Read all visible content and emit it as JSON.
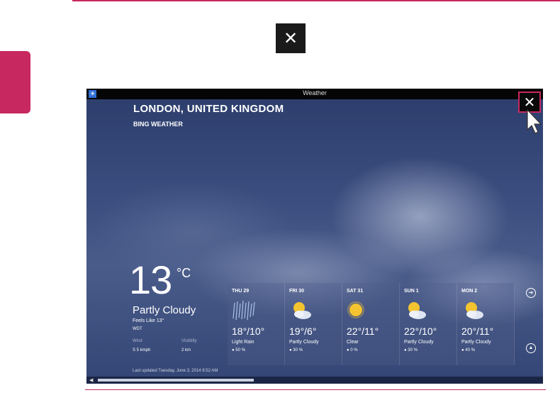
{
  "page": {
    "close_glyph": "✕"
  },
  "window": {
    "title": "Weather",
    "close_glyph": "✕",
    "app_icon_glyph": "☀"
  },
  "location": {
    "city": "LONDON, UNITED KINGDOM",
    "provider": "BING WEATHER"
  },
  "current": {
    "temperature": "13",
    "unit": "°C",
    "condition": "Partly Cloudy",
    "feels_like": "Feels Like 13°",
    "station": "WDT",
    "wind_label": "Wind",
    "wind_value": "S 5 kmph",
    "visibility_label": "Visibility",
    "visibility_value": "2 km",
    "last_updated": "Last updated Tuesday, June 3, 2014 8:52 AM"
  },
  "forecast": [
    {
      "day": "THU 29",
      "temp": "18°/10°",
      "condition": "Light Rain",
      "precip": "50 %",
      "icon": "rain-icon"
    },
    {
      "day": "FRI 30",
      "temp": "19°/6°",
      "condition": "Partly Cloudy",
      "precip": "30 %",
      "icon": "partly-cloudy-icon"
    },
    {
      "day": "SAT 31",
      "temp": "22°/11°",
      "condition": "Clear",
      "precip": "0 %",
      "icon": "sun-icon"
    },
    {
      "day": "SUN 1",
      "temp": "22°/10°",
      "condition": "Partly Cloudy",
      "precip": "30 %",
      "icon": "partly-cloudy-icon"
    },
    {
      "day": "MON 2",
      "temp": "20°/11°",
      "condition": "Partly Cloudy",
      "precip": "40 %",
      "icon": "partly-cloudy-icon"
    }
  ],
  "nav": {
    "next_glyph": "➔",
    "up_glyph": "▲",
    "scroll_left_glyph": "◀"
  },
  "colors": {
    "accent": "#c7285f",
    "window_bg": "#3c4f80"
  }
}
